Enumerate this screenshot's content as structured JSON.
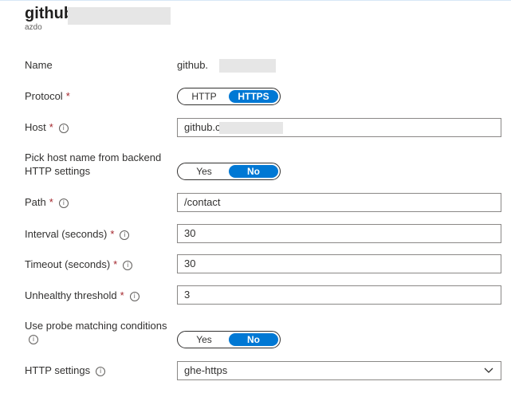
{
  "header": {
    "title": "github",
    "subtitle": "azdo"
  },
  "form": {
    "name": {
      "label": "Name",
      "value": "github."
    },
    "protocol": {
      "label": "Protocol",
      "required": "*",
      "options": [
        "HTTP",
        "HTTPS"
      ],
      "selected": "HTTPS"
    },
    "host": {
      "label": "Host",
      "required": "*",
      "value": "github.c"
    },
    "pick_host": {
      "label_line1": "Pick host name from backend",
      "label_line2": "HTTP settings",
      "options": [
        "Yes",
        "No"
      ],
      "selected": "No"
    },
    "path": {
      "label": "Path",
      "required": "*",
      "value": "/contact"
    },
    "interval": {
      "label": "Interval (seconds)",
      "required": "*",
      "value": "30"
    },
    "timeout": {
      "label": "Timeout (seconds)",
      "required": "*",
      "value": "30"
    },
    "unhealthy": {
      "label": "Unhealthy threshold",
      "required": "*",
      "value": "3"
    },
    "probe_match": {
      "label": "Use probe matching conditions",
      "options": [
        "Yes",
        "No"
      ],
      "selected": "No"
    },
    "http_settings": {
      "label": "HTTP settings",
      "value": "ghe-https"
    }
  },
  "icons": {
    "info": "info-icon",
    "dropdown": "chevron-down-icon"
  },
  "colors": {
    "accent": "#0078d4",
    "required": "#a4262c",
    "border": "#8a8886"
  }
}
